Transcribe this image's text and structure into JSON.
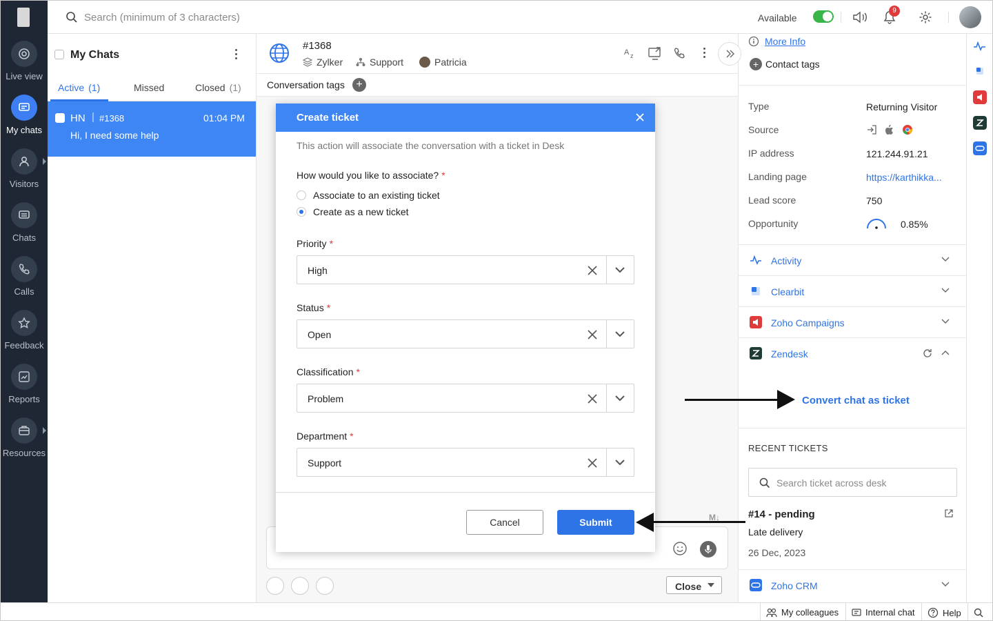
{
  "leftnav": {
    "items": [
      {
        "label": "Live view",
        "icon": "live-view-icon"
      },
      {
        "label": "My chats",
        "icon": "my-chats-icon"
      },
      {
        "label": "Visitors",
        "icon": "visitors-icon"
      },
      {
        "label": "Chats",
        "icon": "chats-icon"
      },
      {
        "label": "Calls",
        "icon": "calls-icon"
      },
      {
        "label": "Feedback",
        "icon": "feedback-icon"
      },
      {
        "label": "Reports",
        "icon": "reports-icon"
      },
      {
        "label": "Resources",
        "icon": "resources-icon"
      }
    ]
  },
  "topbar": {
    "search_placeholder": "Search (minimum of 3 characters)",
    "availability": "Available",
    "notification_count": "9"
  },
  "chatlist": {
    "title": "My Chats",
    "tabs": [
      {
        "label": "Active",
        "count": "(1)"
      },
      {
        "label": "Missed",
        "count": ""
      },
      {
        "label": "Closed",
        "count": "(1)"
      }
    ],
    "chats": [
      {
        "initials": "HN",
        "id": "#1368",
        "time": "01:04 PM",
        "message": "Hi, I need some help"
      }
    ]
  },
  "conversation": {
    "number": "#1368",
    "org": "Zylker",
    "department": "Support",
    "agent": "Patricia",
    "tags_label": "Conversation tags",
    "close_label": "Close"
  },
  "modal": {
    "title": "Create ticket",
    "description": "This action will associate the conversation with a ticket in Desk",
    "question": "How would you like to associate?",
    "options": [
      "Associate to an existing ticket",
      "Create as a new ticket"
    ],
    "selected_option": "Create as a new ticket",
    "fields": [
      {
        "label": "Priority",
        "value": "High"
      },
      {
        "label": "Status",
        "value": "Open"
      },
      {
        "label": "Classification",
        "value": "Problem"
      },
      {
        "label": "Department",
        "value": "Support"
      }
    ],
    "cancel_label": "Cancel",
    "submit_label": "Submit"
  },
  "rpanel": {
    "more_info": "More Info",
    "contact_tags": "Contact tags",
    "details": [
      {
        "label": "Type",
        "value": "Returning Visitor"
      },
      {
        "label": "Source",
        "value": ""
      },
      {
        "label": "IP address",
        "value": "121.244.91.21"
      },
      {
        "label": "Landing page",
        "value": "https://karthikka..."
      },
      {
        "label": "Lead score",
        "value": "750"
      },
      {
        "label": "Opportunity",
        "value": "0.85%"
      }
    ],
    "sections": [
      {
        "name": "Activity",
        "color": "#2f74e6"
      },
      {
        "name": "Clearbit",
        "color": "#2f74e6"
      },
      {
        "name": "Zoho Campaigns",
        "color": "#e03b3b"
      },
      {
        "name": "Zendesk",
        "color": "#1f3b36"
      }
    ],
    "convert_link": "Convert chat as ticket",
    "recent_tickets_label": "RECENT TICKETS",
    "ticket_search_placeholder": "Search ticket across desk",
    "ticket": {
      "title": "#14 - pending",
      "subject": "Late delivery",
      "date": "26 Dec, 2023"
    },
    "crm_section": "Zoho CRM"
  },
  "statusbar": {
    "colleagues": "My colleagues",
    "internal_chat": "Internal chat",
    "help": "Help"
  },
  "colors": {
    "accent": "#2f74e6",
    "nav_bg": "#1e2733",
    "active_chat": "#3d86f3",
    "available": "#39b54a"
  }
}
